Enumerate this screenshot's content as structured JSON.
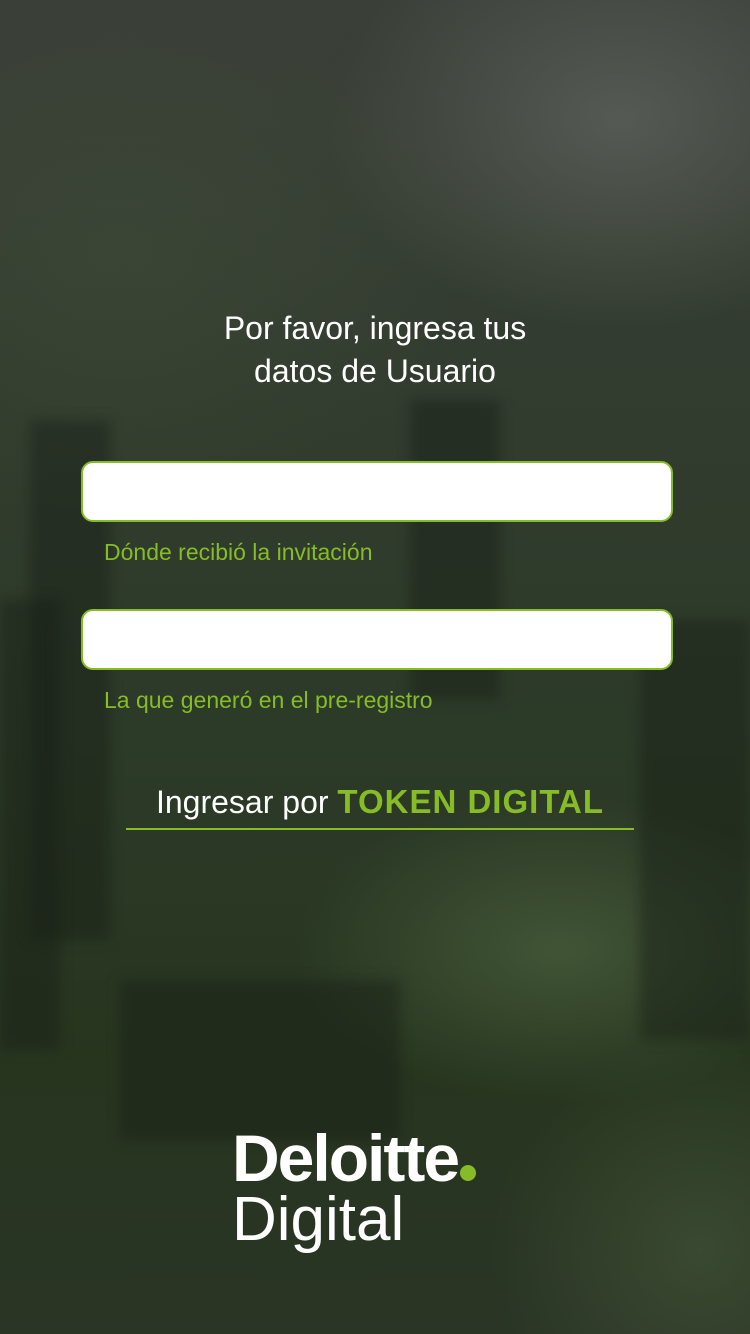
{
  "login": {
    "heading_line1": "Por favor, ingresa tus",
    "heading_line2": "datos de Usuario",
    "username": {
      "value": "",
      "placeholder": "",
      "hint": "Dónde recibió la invitación"
    },
    "password": {
      "value": "",
      "placeholder": "",
      "hint": "La que generó en el pre-registro"
    },
    "token_link": {
      "prefix": "Ingresar por ",
      "emphasis": "TOKEN DIGITAL"
    }
  },
  "brand": {
    "name": "Deloitte",
    "sub": "Digital",
    "logo_icon": "green-dot-icon"
  },
  "colors": {
    "accent": "#86bc25",
    "text": "#ffffff"
  }
}
